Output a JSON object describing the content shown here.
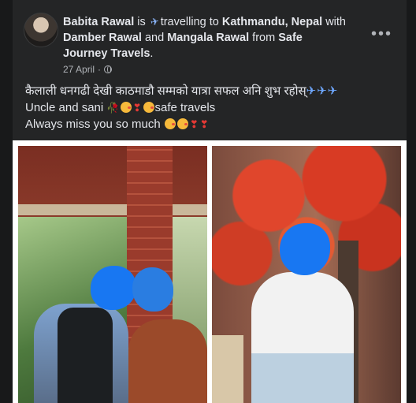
{
  "post": {
    "author": "Babita Rawal",
    "is_text": " is ",
    "activity": "travelling to ",
    "location": "Kathmandu, Nepal",
    "with_text": " with",
    "tag1": "Damber Rawal",
    "and_text": " and ",
    "tag2": "Mangala Rawal",
    "from_text": " from ",
    "from_entity": "Safe Journey Travels",
    "period": ".",
    "date": "27 April",
    "date_sep": "·",
    "more_label": "•••",
    "line1": "कैलाली धनगढी देखी काठमाडौ सम्मको यात्रा सफल अनि शुभ रहोस्",
    "line1_emoji": "✈✈✈",
    "line2_a": "Uncle and sani",
    "line2_b": "safe travels",
    "line3": "Always miss you  so much"
  },
  "icons": {
    "plane": "airplane-icon",
    "globe": "globe-icon",
    "more": "more-options-icon"
  },
  "colors": {
    "background": "#18191a",
    "card": "#242526",
    "text": "#e4e6eb",
    "muted": "#b0b3b8",
    "blur_blob": "#1877f2"
  }
}
